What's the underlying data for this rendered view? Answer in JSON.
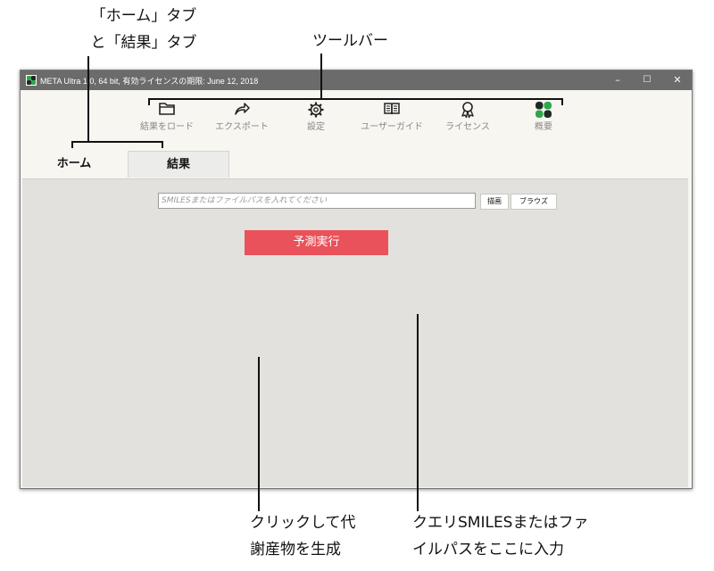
{
  "annotations": {
    "tabs_line1": "「ホーム」タブ",
    "tabs_line2": "と「結果」タブ",
    "toolbar": "ツールバー",
    "run_line1": "クリックして代",
    "run_line2": "謝産物を生成",
    "query_line1": "クエリSMILESまたはファ",
    "query_line2": "イルパスをここに入力"
  },
  "window": {
    "title": "META Ultra 1.0, 64 bit, 有効ライセンスの期限: June 12, 2018",
    "controls": {
      "minimize": "–",
      "maximize": "☐",
      "close": "✕"
    }
  },
  "toolbar": {
    "items": [
      {
        "label": "結果をロード",
        "icon": "folder-icon"
      },
      {
        "label": "エクスポート",
        "icon": "share-arrow-icon"
      },
      {
        "label": "設定",
        "icon": "gear-icon"
      },
      {
        "label": "ユーザーガイド",
        "icon": "book-icon"
      },
      {
        "label": "ライセンス",
        "icon": "ribbon-badge-icon"
      },
      {
        "label": "概要",
        "icon": "clover-logo-icon"
      }
    ]
  },
  "tabs": [
    {
      "label": "ホーム",
      "active": true
    },
    {
      "label": "結果",
      "active": false
    }
  ],
  "home": {
    "smiles_placeholder": "SMILESまたはファイルパスを入れてください",
    "draw_button": "描画",
    "browse_button": "ブラウズ",
    "run_button": "予測実行"
  },
  "colors": {
    "titlebar": "#6b6b6b",
    "run_button": "#e9525a",
    "panel": "#e2e1dd",
    "toolbar_bg": "#f7f6f1",
    "logo_green": "#2ea84a",
    "logo_dark": "#1e2a22"
  }
}
